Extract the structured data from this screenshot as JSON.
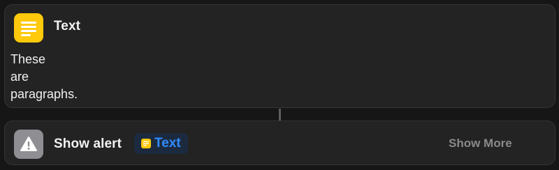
{
  "text_action": {
    "title": "Text",
    "icon": "text-lines-icon",
    "icon_color": "#ffc90c",
    "content": "These\nare\nparagraphs."
  },
  "alert_action": {
    "title": "Show alert",
    "icon": "warning-triangle-icon",
    "icon_color": "#8e8e93",
    "variable_token": {
      "label": "Text",
      "color": "#2f8cff",
      "icon": "text-lines-icon"
    },
    "show_more_label": "Show More"
  }
}
